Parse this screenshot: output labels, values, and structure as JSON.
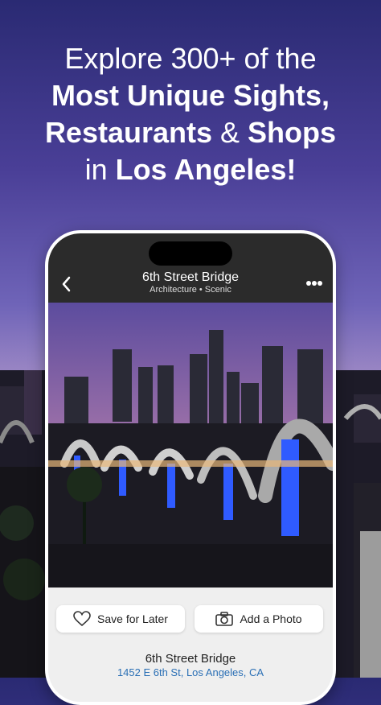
{
  "headline": {
    "line1": "Explore 300+ of the",
    "line2": "Most Unique Sights,",
    "line3_bold": "Restaurants",
    "line3_rest": " & ",
    "line3_bold2": "Shops",
    "line4_pre": "in ",
    "line4_bold": "Los Angeles!"
  },
  "nav": {
    "title": "6th Street Bridge",
    "subtitle": "Architecture • Scenic"
  },
  "actions": {
    "save_label": "Save for Later",
    "photo_label": "Add a Photo"
  },
  "place": {
    "name": "6th Street Bridge",
    "address": "1452 E 6th St, Los Angeles, CA"
  },
  "colors": {
    "link": "#2a6fb5",
    "bridge_light": "#2f5bff"
  }
}
